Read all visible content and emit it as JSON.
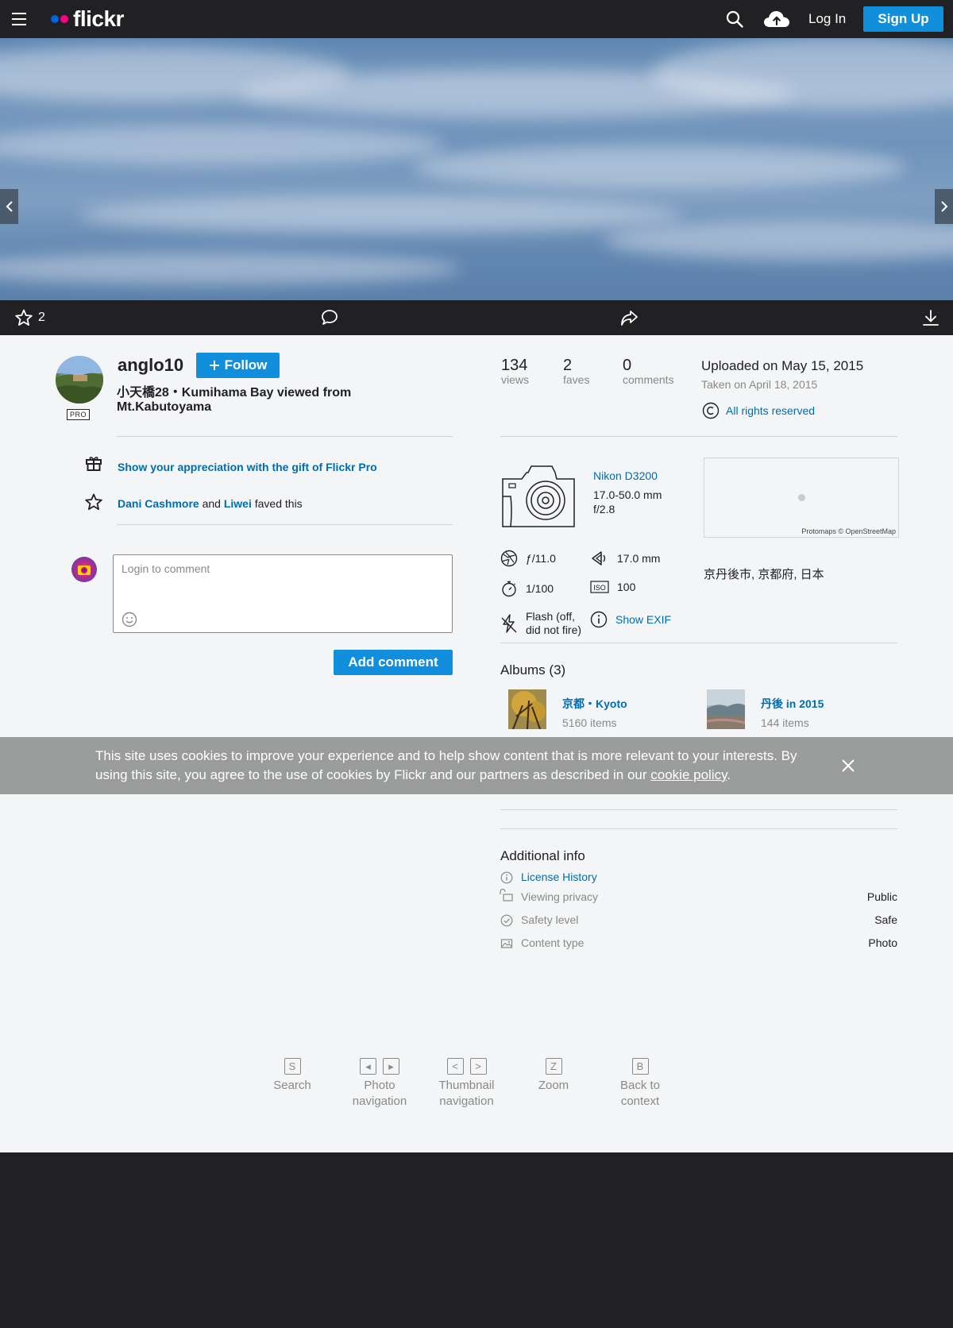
{
  "nav": {
    "logo_text": "flickr",
    "login_label": "Log In",
    "signup_label": "Sign Up"
  },
  "actions": {
    "faves_count": "2"
  },
  "owner": {
    "username": "anglo10",
    "pro_badge": "PRO",
    "follow_label": "Follow"
  },
  "photo": {
    "title": "小天橋28・Kumihama Bay viewed from Mt.Kabutoyama"
  },
  "appreciation": {
    "gift_text": "Show your appreciation with the gift of Flickr Pro",
    "faver1": "Dani Cashmore",
    "and_text": " and ",
    "faver2": "Liwei",
    "faved_suffix": " faved this"
  },
  "comment": {
    "placeholder": "Login to comment",
    "add_label": "Add comment"
  },
  "stats": {
    "views_num": "134",
    "views_label": "views",
    "faves_num": "2",
    "faves_label": "faves",
    "comments_num": "0",
    "comments_label": "comments"
  },
  "dates": {
    "uploaded": "Uploaded on May 15, 2015",
    "taken": "Taken on April 18, 2015"
  },
  "license": {
    "label": "All rights reserved"
  },
  "camera": {
    "name": "Nikon D3200",
    "lens": "17.0-50.0 mm",
    "aperture_max": "f/2.8"
  },
  "map": {
    "attribution": "Protomaps © OpenStreetMap"
  },
  "location": "京丹後市, 京都府, 日本",
  "exif": {
    "aperture": "ƒ/11.0",
    "focal_length": "17.0 mm",
    "shutter": "1/100",
    "iso": "100",
    "flash_line1": "Flash (off,",
    "flash_line2": "did not fire)",
    "show_exif": "Show EXIF"
  },
  "albums": {
    "title": "Albums (3)",
    "items": [
      {
        "name": "京都・Kyoto",
        "count": "5160 items"
      },
      {
        "name": "丹後 in 2015",
        "count": "144 items"
      }
    ]
  },
  "cookie": {
    "text": "This site uses cookies to improve your experience and to help show content that is more relevant to your interests. By using this site, you agree to the use of cookies by Flickr and our partners as described in our ",
    "link": "cookie policy",
    "end": "."
  },
  "additional_info": {
    "title": "Additional info",
    "license_history": "License History",
    "rows": [
      {
        "key": "Viewing privacy",
        "value": "Public"
      },
      {
        "key": "Safety level",
        "value": "Safe"
      },
      {
        "key": "Content type",
        "value": "Photo"
      }
    ]
  },
  "shortcuts": [
    {
      "keys": [
        "S"
      ],
      "label1": "Search",
      "label2": ""
    },
    {
      "keys": [
        "◂",
        "▸"
      ],
      "label1": "Photo",
      "label2": "navigation"
    },
    {
      "keys": [
        "<",
        ">"
      ],
      "label1": "Thumbnail",
      "label2": "navigation"
    },
    {
      "keys": [
        "Z"
      ],
      "label1": "Zoom",
      "label2": ""
    },
    {
      "keys": [
        "B"
      ],
      "label1": "Back to",
      "label2": "context"
    }
  ],
  "colors": {
    "link": "#006dac",
    "primary_button": "#128fdc",
    "nav_bg": "#212124",
    "page_bg": "#f3f5f6"
  }
}
